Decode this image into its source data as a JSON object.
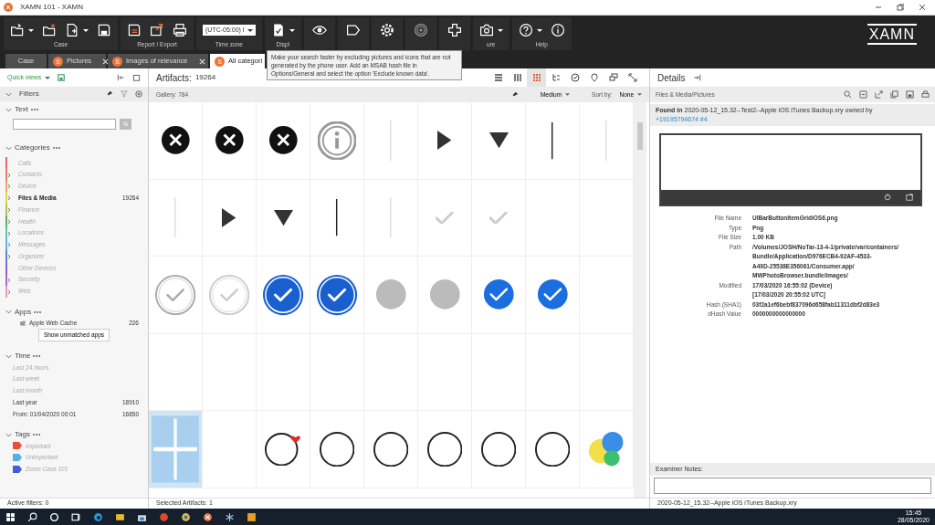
{
  "window": {
    "title": "XAMN 101  - XAMN"
  },
  "toolbar": {
    "groups": [
      {
        "label": "Case"
      },
      {
        "label": "Report / Export"
      },
      {
        "label": "Time zone"
      },
      {
        "label": "Displ"
      },
      {
        "label": "ure"
      },
      {
        "label": "Help"
      }
    ],
    "time_zone": "(UTC-05:00) I",
    "logo": "XAMN"
  },
  "tooltip": {
    "text": "Make your search faster by excluding pictures and icons that are not generated by the phone user. Add an MSAB hash file in Options/General and select the option 'Exclude known data'."
  },
  "tabs": [
    {
      "label": "Case",
      "closable": false,
      "selected": false
    },
    {
      "label": "Pictures",
      "badge": "S",
      "closable": true,
      "selected": false
    },
    {
      "label": "Images of relevance",
      "badge": "S",
      "closable": true,
      "selected": false
    },
    {
      "label": "All categori",
      "badge": "S",
      "closable": false,
      "selected": true
    }
  ],
  "filters": {
    "quick_views": "Quick views",
    "title": "Filters",
    "text_title": "Text",
    "categories": {
      "title": "Categories",
      "items": [
        {
          "name": "Calls",
          "expandable": false,
          "available": false,
          "color": "#e06a6a"
        },
        {
          "name": "Contacts",
          "expandable": true,
          "available": false,
          "color": "#e8806a"
        },
        {
          "name": "Device",
          "expandable": true,
          "available": false,
          "color": "#f0a860"
        },
        {
          "name": "Files & Media",
          "count": "19264",
          "expandable": true,
          "available": true,
          "color": "#e8d448"
        },
        {
          "name": "Finance",
          "expandable": true,
          "available": false,
          "color": "#a8c850"
        },
        {
          "name": "Health",
          "expandable": true,
          "available": false,
          "color": "#60b060"
        },
        {
          "name": "Locations",
          "expandable": true,
          "available": false,
          "color": "#58c8a8"
        },
        {
          "name": "Messages",
          "expandable": true,
          "available": false,
          "color": "#58b8e0"
        },
        {
          "name": "Organizer",
          "expandable": true,
          "available": false,
          "color": "#5888d8"
        },
        {
          "name": "Other Devices",
          "expandable": false,
          "available": false,
          "color": "#7868d8"
        },
        {
          "name": "Security",
          "expandable": true,
          "available": false,
          "color": "#a868d0"
        },
        {
          "name": "Web",
          "expandable": true,
          "available": false,
          "color": "#e898c8"
        }
      ]
    },
    "apps": {
      "title": "Apps",
      "items": [
        {
          "name": "Apple Web Cache",
          "count": "226"
        }
      ],
      "button": "Show unmatched apps"
    },
    "time": {
      "title": "Time",
      "items": [
        {
          "name": "Last 24 hours",
          "available": false
        },
        {
          "name": "Last week",
          "available": false
        },
        {
          "name": "Last month",
          "available": false
        },
        {
          "name": "Last year",
          "count": "18910",
          "available": true
        },
        {
          "name": "From:  01/04/2020 00:01",
          "count": "16850",
          "available": true
        }
      ]
    },
    "tags": {
      "title": "Tags",
      "items": [
        {
          "name": "Important",
          "color": "#e8503a"
        },
        {
          "name": "Unimportant",
          "color": "#5aaee8"
        },
        {
          "name": "Zoom Case 101",
          "color": "#4060d8"
        }
      ]
    },
    "status": "Active filters: 0"
  },
  "gallery": {
    "artifacts_label": "Artifacts:",
    "artifacts_count": "19264",
    "views": [
      {
        "kind": "list",
        "selected": false
      },
      {
        "kind": "columns",
        "selected": false
      },
      {
        "kind": "grid",
        "selected": true
      },
      {
        "kind": "tree",
        "selected": false
      },
      {
        "kind": "clock",
        "selected": false
      },
      {
        "kind": "pin",
        "selected": false
      },
      {
        "kind": "chat",
        "selected": false
      },
      {
        "kind": "graph",
        "selected": false
      }
    ],
    "title": "Gallery: 784",
    "size": "Medium",
    "sort_label": "Sort by:",
    "sort": "None",
    "cells": [
      {
        "kind": "x-circle",
        "selected": false
      },
      {
        "kind": "x-circle",
        "selected": false
      },
      {
        "kind": "x-circle",
        "selected": false
      },
      {
        "kind": "info-ring",
        "selected": false
      },
      {
        "kind": "faint-vline",
        "selected": false
      },
      {
        "kind": "play",
        "selected": false
      },
      {
        "kind": "down-triangle",
        "selected": false
      },
      {
        "kind": "vline",
        "selected": false
      },
      {
        "kind": "faint-vline",
        "selected": false
      },
      {
        "kind": "faint-vline",
        "selected": false
      },
      {
        "kind": "play",
        "selected": false
      },
      {
        "kind": "down-triangle",
        "selected": false
      },
      {
        "kind": "vline",
        "selected": false
      },
      {
        "kind": "faint-vline",
        "selected": false
      },
      {
        "kind": "faint-check",
        "selected": false
      },
      {
        "kind": "faint-check",
        "selected": false
      },
      {
        "kind": "empty",
        "selected": false
      },
      {
        "kind": "empty",
        "selected": false
      },
      {
        "kind": "check-ring",
        "selected": false
      },
      {
        "kind": "faint-check-ring",
        "selected": false
      },
      {
        "kind": "blue-check",
        "selected": false
      },
      {
        "kind": "blue-check",
        "selected": false
      },
      {
        "kind": "grey-dot",
        "selected": false
      },
      {
        "kind": "grey-dot",
        "selected": false
      },
      {
        "kind": "blue-check-small",
        "selected": false
      },
      {
        "kind": "blue-check-small",
        "selected": false
      },
      {
        "kind": "empty",
        "selected": false
      },
      {
        "kind": "empty",
        "selected": false
      },
      {
        "kind": "empty",
        "selected": false
      },
      {
        "kind": "empty",
        "selected": false
      },
      {
        "kind": "empty",
        "selected": false
      },
      {
        "kind": "empty",
        "selected": false
      },
      {
        "kind": "empty",
        "selected": false
      },
      {
        "kind": "empty",
        "selected": false
      },
      {
        "kind": "empty",
        "selected": false
      },
      {
        "kind": "empty",
        "selected": false
      },
      {
        "kind": "grid-tile",
        "selected": true
      },
      {
        "kind": "empty",
        "selected": false
      },
      {
        "kind": "sticker-heart",
        "selected": false
      },
      {
        "kind": "sticker",
        "selected": false
      },
      {
        "kind": "sticker",
        "selected": false
      },
      {
        "kind": "sticker",
        "selected": false
      },
      {
        "kind": "sticker",
        "selected": false
      },
      {
        "kind": "sticker",
        "selected": false
      },
      {
        "kind": "bubbles",
        "selected": false
      }
    ],
    "status": "Selected Artifacts: 1"
  },
  "details": {
    "title": "Details",
    "category": "Files & Media/Pictures",
    "found_in": "**Found in** 2020-05-12_15.32--Test2--Apple iOS iTunes Backup.xry owned by",
    "owner": "+19195794674 #4",
    "fields": [
      {
        "label": "File Name",
        "lines": [
          "UIBarButtonItemGridiOS6.png"
        ]
      },
      {
        "label": "Type",
        "lines": [
          "Png"
        ]
      },
      {
        "label": "File Size",
        "lines": [
          "1.00 KB"
        ]
      },
      {
        "label": "Path",
        "lines": [
          "/Volumes/JOSH/NoTar-13-4-1/private/var/containers/",
          "Bundle/Application/D976ECB4-92AF-4533-",
          "A49D-25538E356061/Consumer.app/",
          "MWPhotoBrowser.bundle/images/"
        ]
      },
      {
        "label": "Modified",
        "lines": [
          "17/03/2020 16:55:02 (Device)",
          "[17/03/2020 20:55:02 UTC]"
        ]
      },
      {
        "label": "Hash (SHA1)",
        "lines": [
          "03f2a1ef6bebf837096d658fab11311dbf2d83e3"
        ]
      },
      {
        "label": "dHash Value",
        "lines": [
          "0000000000000000"
        ]
      }
    ],
    "notes_label": "Examiner Notes:",
    "status": "2020-05-12_15.32--Apple iOS iTunes Backup.xry"
  },
  "taskbar": {
    "time": "15:45",
    "date": "28/05/2020"
  }
}
